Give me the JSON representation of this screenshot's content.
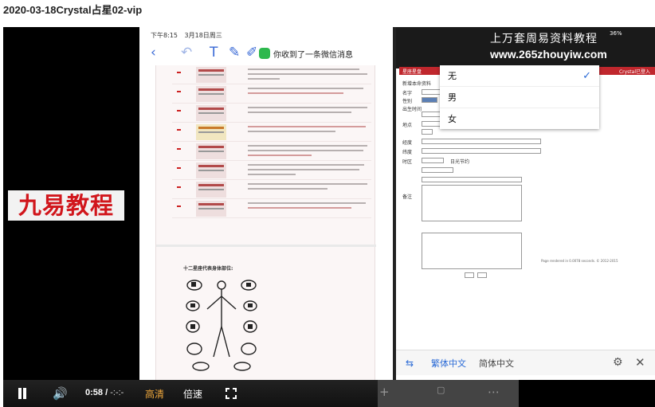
{
  "video": {
    "title": "2020-03-18Crystal占星02-vip",
    "brand": "九易教程",
    "controls": {
      "current_time": "0:58",
      "separator": "/",
      "duration": "-:-:-",
      "quality": "高清",
      "speed": "倍速"
    }
  },
  "tablet": {
    "status_time": "下午8:15",
    "status_date": "3月18日周三",
    "notification": "你收到了一条微信消息",
    "doc_section_title": "十二星座代表身体部位:",
    "watermark_line1": "上万套周易资料教程",
    "watermark_line2": "www.265zhouyiw.com",
    "battery": "36%",
    "site_tab": "星座星盘",
    "site_right": "Crystal已登入",
    "footer_text": "Page rendered in 0.0078 seconds. © 2012-2015",
    "dropdown_options": [
      {
        "label": "无",
        "selected": true
      },
      {
        "label": "男",
        "selected": false
      },
      {
        "label": "女",
        "selected": false
      }
    ],
    "form_labels": [
      "新增本命资料",
      "名字",
      "性别",
      "出生时间",
      "地点",
      "经度",
      "纬度",
      "时区",
      "日光节约",
      "备注"
    ],
    "translate": {
      "option_traditional": "繁体中文",
      "option_simplified": "简体中文"
    }
  },
  "colors": {
    "brand_red": "#d1161c",
    "quality_orange": "#f0a83c",
    "site_red": "#c0272d",
    "link_blue": "#2a6ad6"
  }
}
